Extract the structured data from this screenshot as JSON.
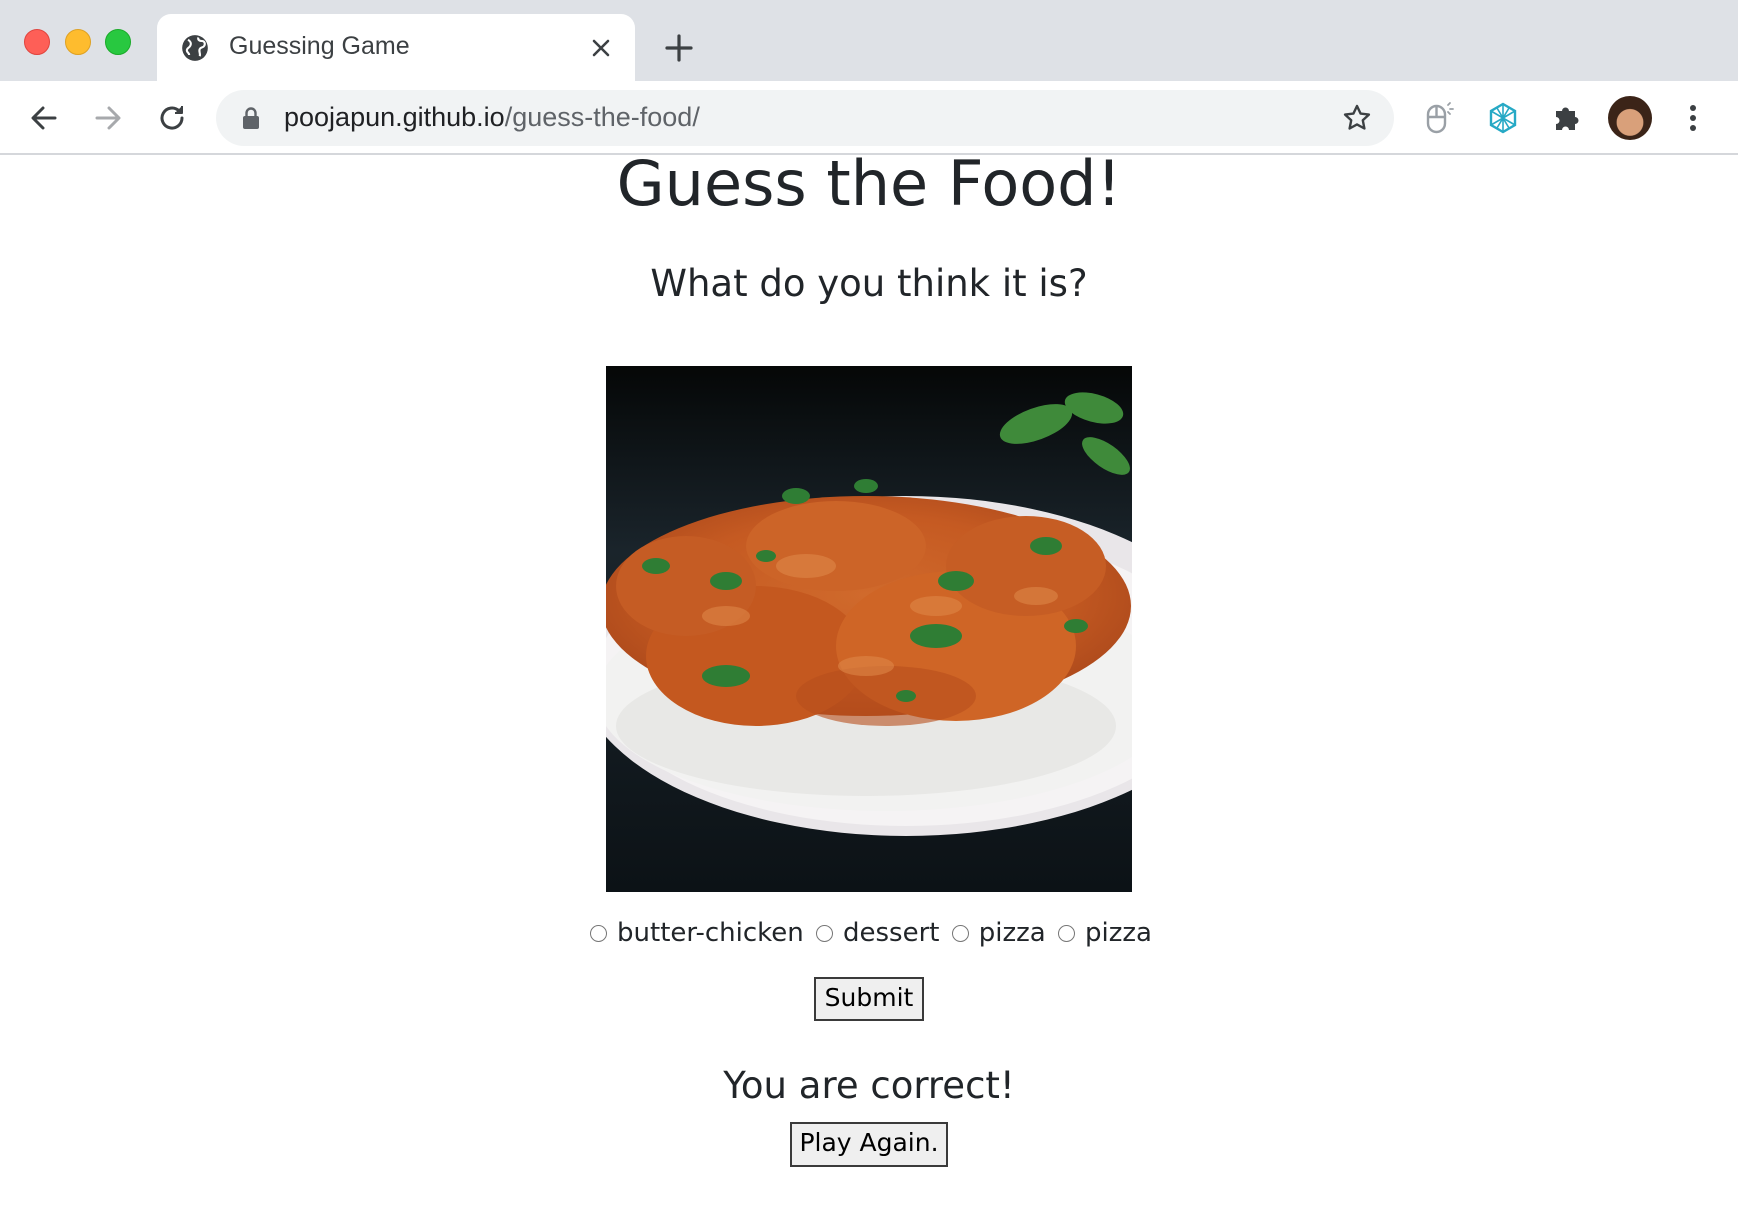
{
  "browser": {
    "tab_title": "Guessing Game",
    "url_host": "poojapun.github.io",
    "url_path": "/guess-the-food/"
  },
  "page": {
    "title": "Guess the Food!",
    "subtitle": "What do you think it is?",
    "image_alt": "butter chicken on rice",
    "choices": [
      {
        "label": "butter-chicken",
        "selected": false
      },
      {
        "label": "dessert",
        "selected": false
      },
      {
        "label": "pizza",
        "selected": false
      },
      {
        "label": "pizza",
        "selected": false
      }
    ],
    "submit_label": "Submit",
    "result_text": "You are correct!",
    "play_again_label": "Play Again."
  },
  "colors": {
    "text": "#212529",
    "chrome_bg": "#dee1e6",
    "omnibox_bg": "#f1f3f4",
    "button_bg": "#efefef"
  }
}
